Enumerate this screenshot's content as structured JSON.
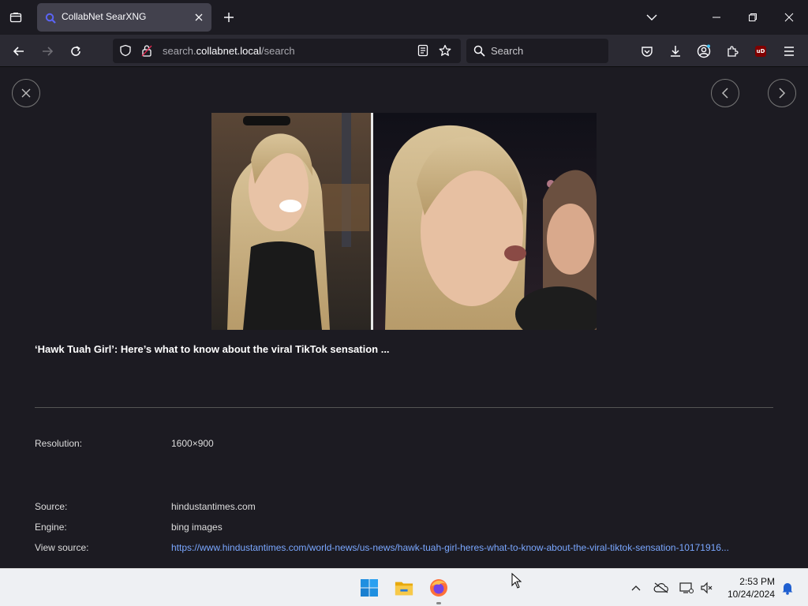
{
  "browser": {
    "tab_title": "CollabNet SearXNG",
    "url_prefix": "search.",
    "url_domain": "collabnet.local",
    "url_path": "/search",
    "search_placeholder": "Search",
    "ublock_label": "uD"
  },
  "result": {
    "title": "‘Hawk Tuah Girl’: Here’s what to know about the viral TikTok sensation ...",
    "resolution_label": "Resolution:",
    "resolution_value": "1600×900",
    "source_label": "Source:",
    "source_value": "hindustantimes.com",
    "engine_label": "Engine:",
    "engine_value": "bing images",
    "view_source_label": "View source:",
    "view_source_value": "https://www.hindustantimes.com/world-news/us-news/hawk-tuah-girl-heres-what-to-know-about-the-viral-tiktok-sensation-10171916..."
  },
  "taskbar": {
    "time": "2:53 PM",
    "date": "10/24/2024"
  },
  "colors": {
    "accent_link": "#7aa7ff",
    "tab_bg": "#42414d",
    "nav_bg": "#2b2a33",
    "page_bg": "#1c1b22"
  },
  "icons": [
    "tab-list-icon",
    "search-favicon-icon",
    "close-icon",
    "plus-icon",
    "chevron-down-icon",
    "minimize-icon",
    "restore-icon",
    "back-icon",
    "forward-icon",
    "reload-icon",
    "shield-icon",
    "lock-icon",
    "reader-icon",
    "star-icon",
    "magnifier-icon",
    "pocket-icon",
    "download-icon",
    "account-icon",
    "extensions-icon",
    "ublock-icon",
    "menu-icon",
    "arrow-left-icon",
    "arrow-right-icon",
    "windows-start-icon",
    "file-explorer-icon",
    "firefox-icon",
    "chevron-up-icon",
    "onedrive-icon",
    "network-icon",
    "volume-icon",
    "bell-icon"
  ]
}
